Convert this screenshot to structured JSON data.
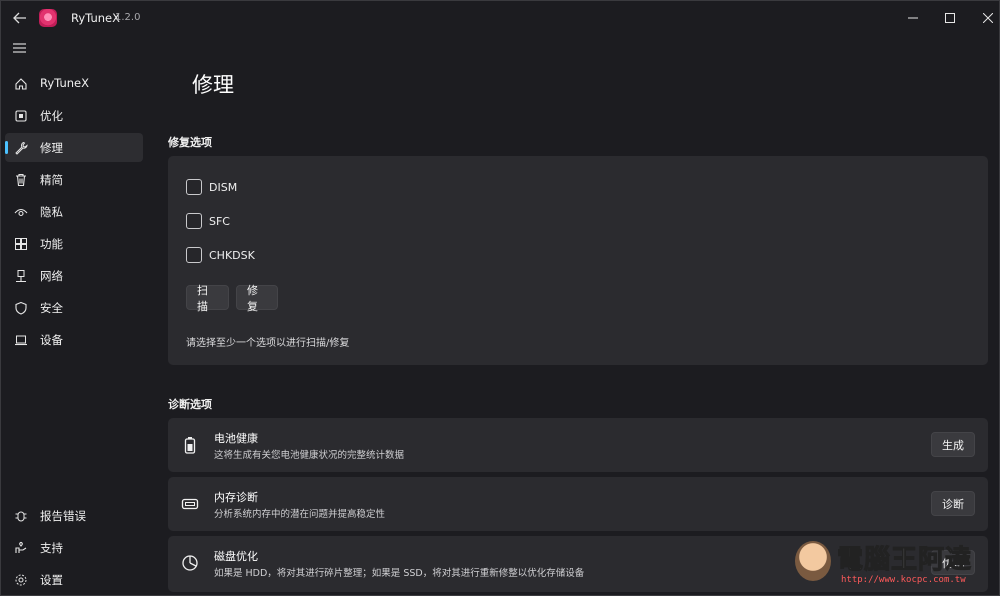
{
  "app": {
    "title": "RyTuneX",
    "version": "1.2.0"
  },
  "sidebar": {
    "items": [
      {
        "label": "RyTuneX",
        "icon": "home-icon"
      },
      {
        "label": "优化",
        "icon": "optimize-icon"
      },
      {
        "label": "修理",
        "icon": "wrench-icon",
        "active": true
      },
      {
        "label": "精简",
        "icon": "trash-icon"
      },
      {
        "label": "隐私",
        "icon": "eye-icon"
      },
      {
        "label": "功能",
        "icon": "features-icon"
      },
      {
        "label": "网络",
        "icon": "network-icon"
      },
      {
        "label": "安全",
        "icon": "shield-icon"
      },
      {
        "label": "设备",
        "icon": "laptop-icon"
      }
    ],
    "footer": [
      {
        "label": "报告错误",
        "icon": "bug-icon"
      },
      {
        "label": "支持",
        "icon": "support-icon"
      },
      {
        "label": "设置",
        "icon": "gear-icon"
      }
    ]
  },
  "page": {
    "title": "修理"
  },
  "repair": {
    "section_title": "修复选项",
    "options": [
      {
        "label": "DISM",
        "checked": false
      },
      {
        "label": "SFC",
        "checked": false
      },
      {
        "label": "CHKDSK",
        "checked": false
      }
    ],
    "scan_label": "扫描",
    "fix_label": "修复",
    "hint": "请选择至少一个选项以进行扫描/修复"
  },
  "diagnostics": {
    "section_title": "诊断选项",
    "items": [
      {
        "title": "电池健康",
        "desc": "这将生成有关您电池健康状况的完整统计数据",
        "button": "生成",
        "icon": "battery-icon"
      },
      {
        "title": "内存诊断",
        "desc": "分析系统内存中的潜在问题并提高稳定性",
        "button": "诊断",
        "icon": "memory-icon"
      },
      {
        "title": "磁盘优化",
        "desc": "如果是 HDD，将对其进行碎片整理；如果是 SSD，将对其进行重新修整以优化存储设备",
        "button": "优化",
        "icon": "disk-icon"
      }
    ]
  },
  "watermark": {
    "text": "電腦王阿達",
    "url": "http://www.kocpc.com.tw"
  },
  "colors": {
    "accent": "#4cc2ff",
    "background": "#1c1c20",
    "card": "#2b2b2f"
  }
}
